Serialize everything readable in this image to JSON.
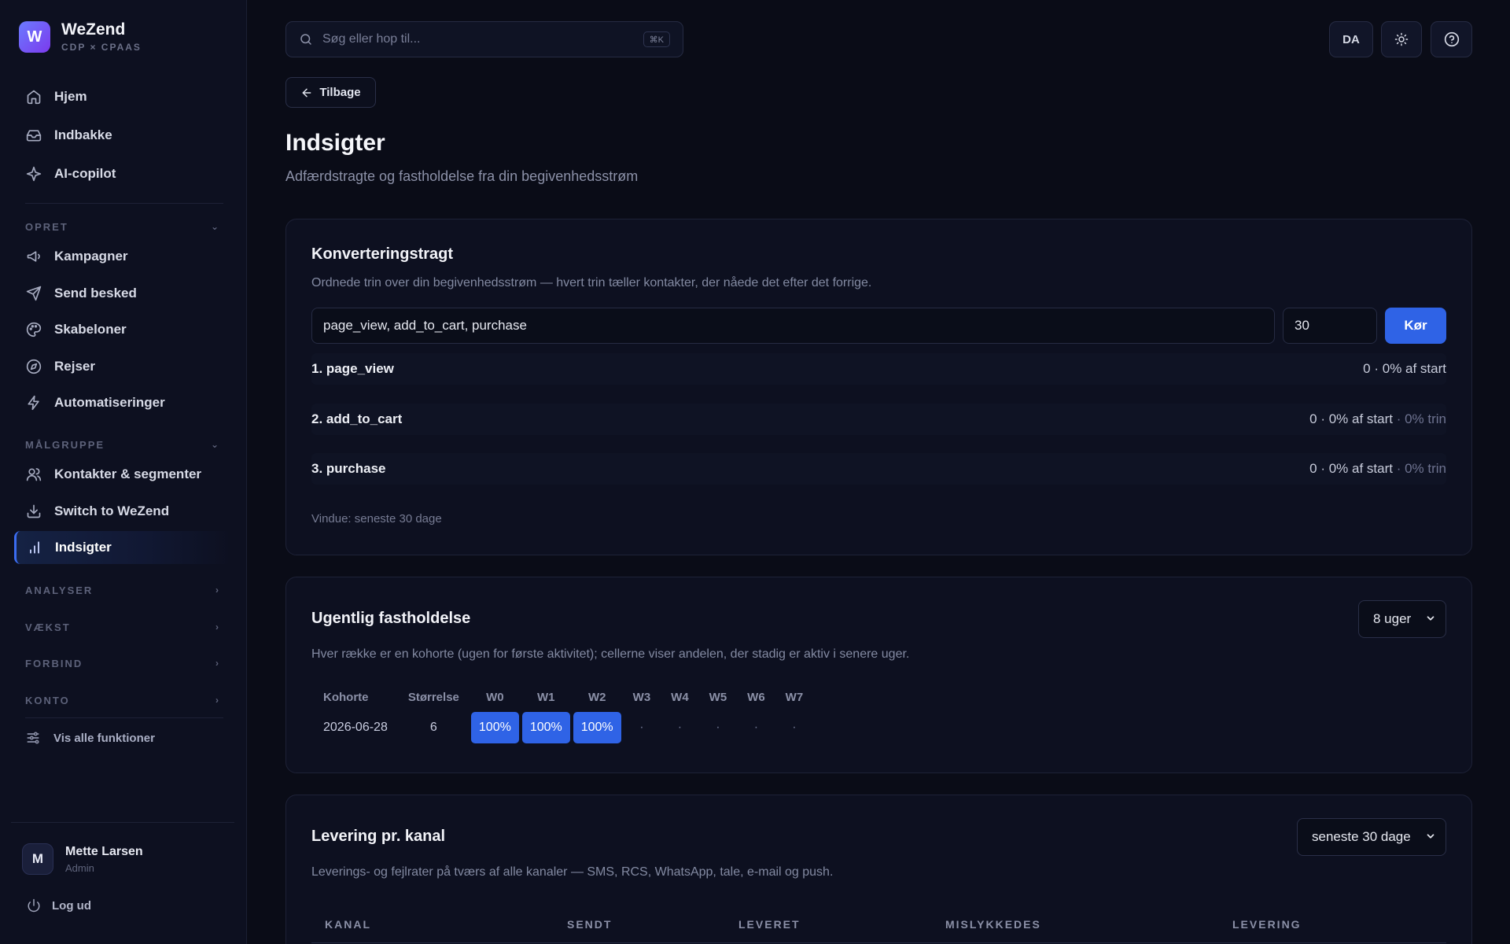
{
  "brand": {
    "logo_letter": "W",
    "name": "WeZend",
    "subtitle": "CDP × CPAAS"
  },
  "nav": {
    "top": [
      {
        "label": "Hjem",
        "icon": "home-icon"
      },
      {
        "label": "Indbakke",
        "icon": "inbox-icon"
      },
      {
        "label": "AI-copilot",
        "icon": "sparkle-icon"
      }
    ],
    "sections": {
      "opret": "OPRET",
      "maalgruppe": "MÅLGRUPPE",
      "analyser": "ANALYSER",
      "vaekst": "VÆKST",
      "forbind": "FORBIND",
      "konto": "KONTO"
    },
    "opret_items": [
      {
        "label": "Kampagner",
        "icon": "megaphone-icon"
      },
      {
        "label": "Send besked",
        "icon": "send-icon"
      },
      {
        "label": "Skabeloner",
        "icon": "palette-icon"
      },
      {
        "label": "Rejser",
        "icon": "compass-icon"
      },
      {
        "label": "Automatiseringer",
        "icon": "bolt-icon"
      }
    ],
    "maalgruppe_items": [
      {
        "label": "Kontakter & segmenter",
        "icon": "users-icon"
      },
      {
        "label": "Switch to WeZend",
        "icon": "download-icon"
      },
      {
        "label": "Indsigter",
        "icon": "bar-chart-icon",
        "active": true
      }
    ],
    "all_functions": "Vis alle funktioner"
  },
  "user": {
    "initial": "M",
    "name": "Mette Larsen",
    "role": "Admin",
    "logout": "Log ud"
  },
  "topbar": {
    "search_placeholder": "Søg eller hop til...",
    "shortcut": "⌘K",
    "lang": "DA"
  },
  "page": {
    "back": "Tilbage",
    "title": "Indsigter",
    "subtitle": "Adfærdstragte og fastholdelse fra din begivenhedsstrøm"
  },
  "funnel": {
    "title": "Konverteringstragt",
    "description": "Ordnede trin over din begivenhedsstrøm — hvert trin tæller kontakter, der nåede det efter det forrige.",
    "steps_value": "page_view, add_to_cart, purchase",
    "days_value": "30",
    "run": "Kør",
    "steps": [
      {
        "name": "1. page_view",
        "value": "0 · 0% af start",
        "extra": ""
      },
      {
        "name": "2. add_to_cart",
        "value": "0 · 0% af start",
        "extra": " · 0% trin"
      },
      {
        "name": "3. purchase",
        "value": "0 · 0% af start",
        "extra": " · 0% trin"
      }
    ],
    "window_note": "Vindue: seneste 30 dage"
  },
  "retention": {
    "title": "Ugentlig fastholdelse",
    "period": "8 uger",
    "description": "Hver række er en kohorte (ugen for første aktivitet); cellerne viser andelen, der stadig er aktiv i senere uger.",
    "headers": [
      "Kohorte",
      "Størrelse",
      "W0",
      "W1",
      "W2",
      "W3",
      "W4",
      "W5",
      "W6",
      "W7"
    ],
    "rows": [
      {
        "cohort": "2026-06-28",
        "size": "6",
        "cells": [
          "100%",
          "100%",
          "100%",
          "·",
          "·",
          "·",
          "·",
          "·"
        ]
      }
    ]
  },
  "delivery": {
    "title": "Levering pr. kanal",
    "period": "seneste 30 dage",
    "description": "Leverings- og fejlrater på tværs af alle kanaler — SMS, RCS, WhatsApp, tale, e-mail og push.",
    "headers": [
      "KANAL",
      "SENDT",
      "LEVERET",
      "MISLYKKEDES",
      "LEVERING"
    ]
  },
  "colors": {
    "accent": "#2f63e6",
    "background": "#0a0c17",
    "sidebar": "#0d1020"
  }
}
